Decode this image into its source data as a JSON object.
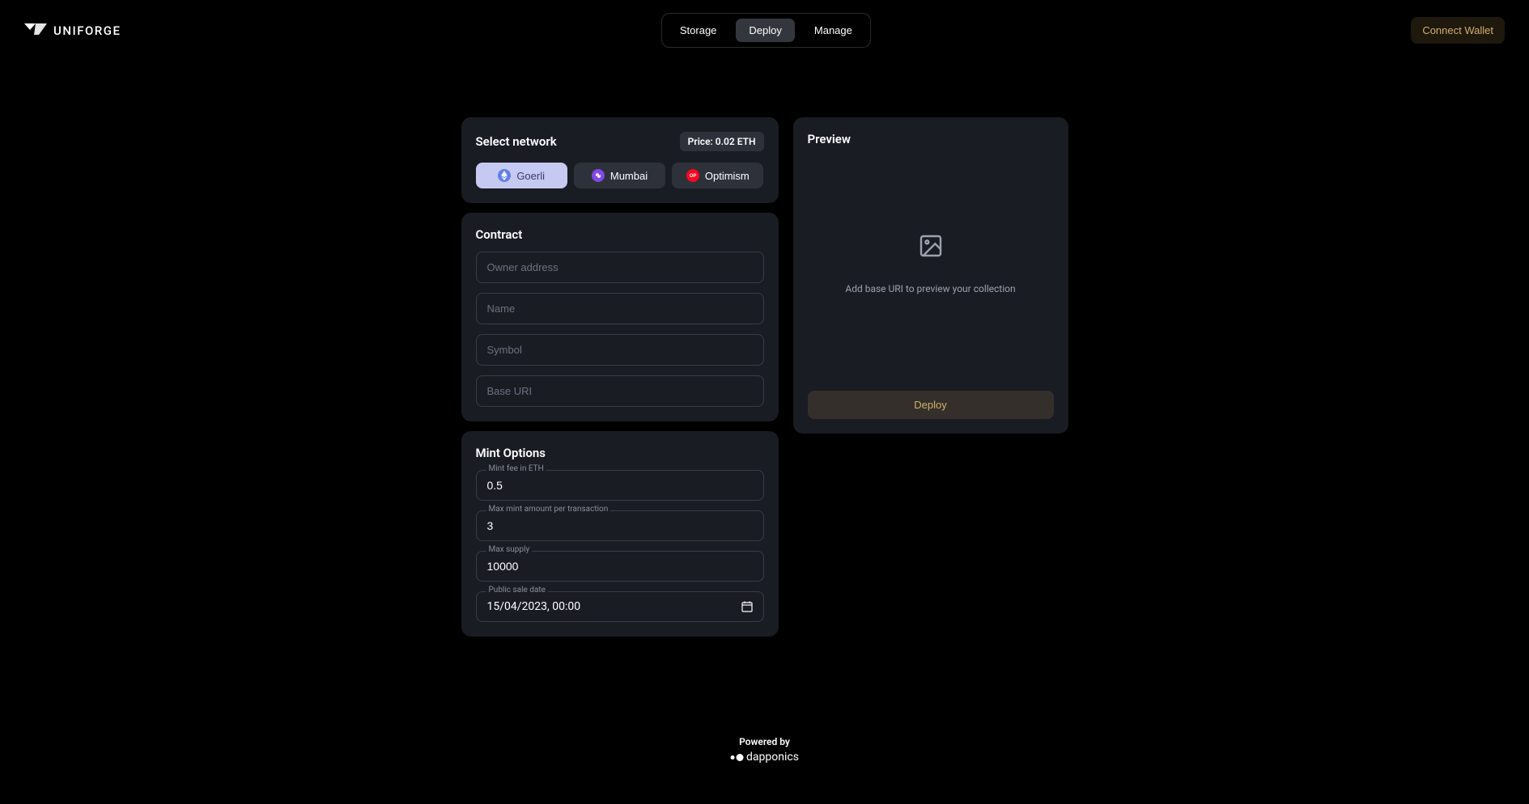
{
  "header": {
    "logo_text": "UNIFORGE",
    "nav": {
      "storage": "Storage",
      "deploy": "Deploy",
      "manage": "Manage"
    },
    "connect_wallet": "Connect Wallet"
  },
  "select_network": {
    "title": "Select network",
    "price": "Price: 0.02 ETH",
    "networks": {
      "goerli": "Goerli",
      "mumbai": "Mumbai",
      "optimism": "Optimism"
    }
  },
  "contract": {
    "title": "Contract",
    "placeholders": {
      "owner": "Owner address",
      "name": "Name",
      "symbol": "Symbol",
      "base_uri": "Base URI"
    }
  },
  "mint_options": {
    "title": "Mint Options",
    "labels": {
      "mint_fee": "Mint fee in ETH",
      "max_mint": "Max mint amount per transaction",
      "max_supply": "Max supply",
      "sale_date": "Public sale date"
    },
    "values": {
      "mint_fee": "0.5",
      "max_mint": "3",
      "max_supply": "10000",
      "sale_date": "15/04/2023, 00:00"
    }
  },
  "preview": {
    "title": "Preview",
    "empty_text": "Add base URI to preview your collection",
    "deploy_btn": "Deploy"
  },
  "footer": {
    "powered_by": "Powered by",
    "brand": "dapponics"
  }
}
